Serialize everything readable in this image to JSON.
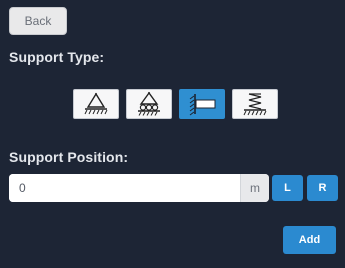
{
  "nav": {
    "back_label": "Back"
  },
  "support_type": {
    "label": "Support Type:",
    "options": [
      {
        "icon": "pin-support-icon",
        "selected": false
      },
      {
        "icon": "roller-support-icon",
        "selected": false
      },
      {
        "icon": "fixed-support-icon",
        "selected": true
      },
      {
        "icon": "spring-support-icon",
        "selected": false
      }
    ]
  },
  "support_position": {
    "label": "Support Position:",
    "value": "0",
    "placeholder": "",
    "unit": "m",
    "left_label": "L",
    "right_label": "R"
  },
  "actions": {
    "add_label": "Add"
  },
  "colors": {
    "background": "#1d2535",
    "accent": "#2b8ad0",
    "selected": "#2f8fd1",
    "text": "#e4e7ec"
  }
}
